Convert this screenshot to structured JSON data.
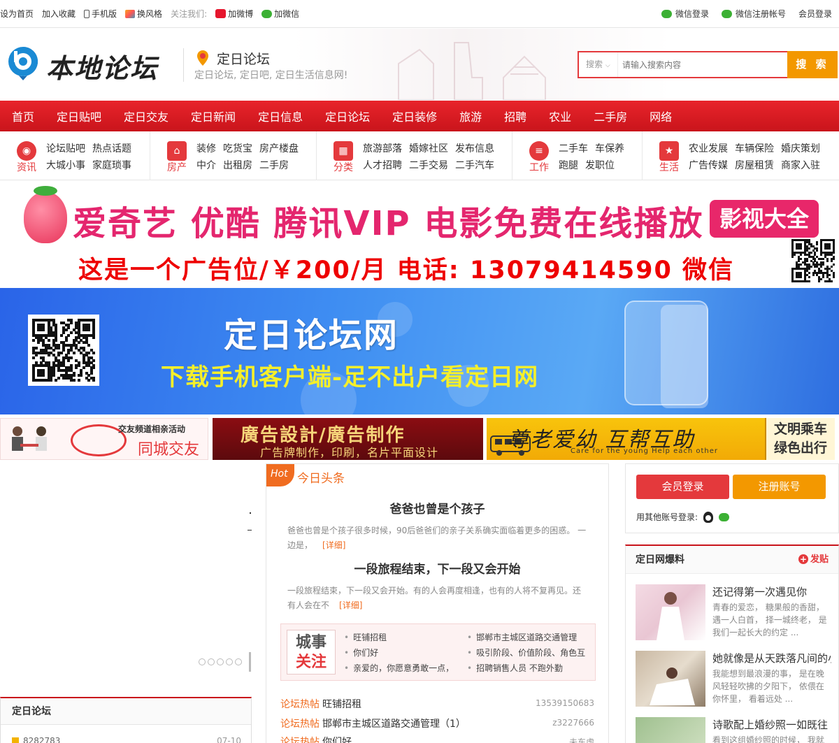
{
  "topbar": {
    "left": [
      "设为首页",
      "加入收藏",
      "手机版",
      "换风格"
    ],
    "follow_label": "关注我们:",
    "weibo": "加微博",
    "weixin": "加微信",
    "right": [
      "微信登录",
      "微信注册帐号",
      "会员登录"
    ]
  },
  "header": {
    "logo_text": "本地论坛",
    "site_name": "定日论坛",
    "slogan": "定日论坛, 定日吧, 定日生活信息网!",
    "search_select": "搜索",
    "search_placeholder": "请输入搜索内容",
    "search_button": "搜 索"
  },
  "nav": [
    "首页",
    "定日贴吧",
    "定日交友",
    "定日新闻",
    "定日信息",
    "定日论坛",
    "定日装修",
    "旅游",
    "招聘",
    "农业",
    "二手房",
    "网络"
  ],
  "categories": [
    {
      "label": "资讯",
      "icon": "news-icon",
      "row1": [
        "论坛贴吧",
        "热点话题"
      ],
      "row2": [
        "大城小事",
        "家庭琐事"
      ]
    },
    {
      "label": "房产",
      "icon": "home-icon",
      "row1": [
        "装修",
        "吃货宝",
        "房产楼盘"
      ],
      "row2": [
        "中介",
        "出租房",
        "二手房"
      ]
    },
    {
      "label": "分类",
      "icon": "grid-icon",
      "row1": [
        "旅游部落",
        "婚嫁社区",
        "发布信息"
      ],
      "row2": [
        "人才招聘",
        "二手交易",
        "二手汽车"
      ]
    },
    {
      "label": "工作",
      "icon": "layers-icon",
      "row1": [
        "二手车",
        "车保养"
      ],
      "row2": [
        "跑腿",
        "发职位"
      ]
    },
    {
      "label": "生活",
      "icon": "star-icon",
      "row1": [
        "农业发展",
        "车辆保险",
        "婚庆策划"
      ],
      "row2": [
        "广告传媒",
        "房屋租赁",
        "商家入驻"
      ]
    }
  ],
  "ad_video": {
    "line1": "爱奇艺 优酷 腾讯VIP 电影免费在线播放",
    "tag": "影视大全",
    "line2": "这是一个广告位/￥200/月 电话: 13079414590 微信"
  },
  "ad_app": {
    "title": "定日论坛网",
    "subtitle": "下载手机客户端-足不出户看定日网"
  },
  "ad_small": {
    "dating_title": "交友频道相亲活动",
    "dating_sub": "同城交友",
    "design_title": "廣告設計/廣告制作",
    "design_sub": "广告牌制作，印刷，名片平面设计",
    "care_title": "尊老爱幼 互帮互助",
    "care_sub": "Care for the young    Help each other",
    "care_right1": "文明乘车",
    "care_right2": "绿色出行"
  },
  "left_box": {
    "title": "定日论坛",
    "row_text": "8282783",
    "row_date": "07-10"
  },
  "headlines": {
    "hot": "Hot",
    "title": "今日头条",
    "articles": [
      {
        "title": "爸爸也曾是个孩子",
        "text": "爸爸也曾是个孩子很多时候，90后爸爸们的亲子关系确实面临着更多的困惑。 一边是，",
        "more": "[详细]"
      },
      {
        "title": "一段旅程结束，下一段又会开始",
        "text": "一段旅程结束，下一段又会开始。有的人会再度相逢，也有的人将不复再见。还有人会在不",
        "more": "[详细]"
      }
    ],
    "city_logo_top": "城事",
    "city_logo_bottom": "关注",
    "city_left": [
      "旺铺招租",
      "你们好",
      "亲爱的，你愿意勇敢一点，"
    ],
    "city_right": [
      "邯郸市主城区道路交通管理",
      "吸引阶段、价值阶段、角色互",
      "招聘销售人员 不跑外勤"
    ],
    "news": [
      {
        "label": "论坛热帖",
        "text": "旺铺招租",
        "author": "13539150683"
      },
      {
        "label": "论坛热帖",
        "text": "邯郸市主城区道路交通管理（1）",
        "author": "z3227666"
      },
      {
        "label": "论坛热帖",
        "text": "你们好",
        "author": "未东虎"
      }
    ]
  },
  "login": {
    "login_button": "会员登录",
    "register_button": "注册账号",
    "other_label": "用其他账号登录:"
  },
  "baoliao": {
    "title": "定日网爆料",
    "post": "发贴",
    "items": [
      {
        "title": "还记得第一次遇见你",
        "desc": "青春的爱恋， 糖果般的香甜，遇一人白首， 择一城终老， 是我们一起长大的约定 ..."
      },
      {
        "title": "她就像是从天跌落凡间的小",
        "desc": "我能想到最浪漫的事， 是在晚风轻轻吹拂的夕阳下， 依偎在你怀里， 看着远处 ..."
      },
      {
        "title": "诗歌配上婚纱照一如既往",
        "desc": "看到这组婚纱照的时候， 我就"
      }
    ]
  },
  "colors": {
    "brand_red": "#e4393c",
    "nav_red": "#c9141b",
    "accent_orange": "#f39800",
    "hot_orange": "#f06c20"
  }
}
